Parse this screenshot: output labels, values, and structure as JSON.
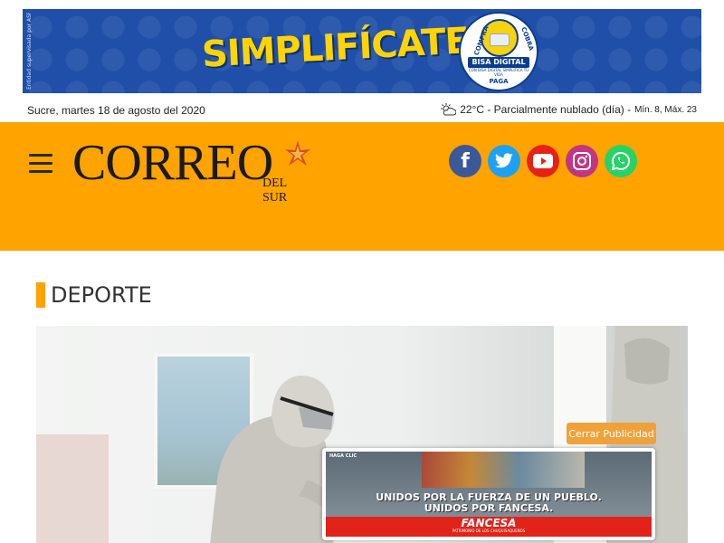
{
  "top_ad": {
    "headline": "SIMPLIFÍCATE",
    "disclaimer": "Entidad supervisada por ASFI",
    "seal_left": "COMPRA",
    "seal_right": "COBRA",
    "seal_center": "BISA DIGITAL",
    "seal_subtext": "CON BISA DIGITAL SIMPLIFICA TU VIDA",
    "seal_bottom": "PAGA"
  },
  "info_bar": {
    "date": "Sucre, martes 18 de agosto del 2020",
    "weather_icon": "partly-cloudy-icon",
    "weather_main": "22°C - Parcialmente nublado (día) -",
    "weather_minmax": "Mín. 8, Máx. 23"
  },
  "header": {
    "background_color": "#ffa300",
    "menu_icon": "hamburger-menu-icon",
    "logo_main": "CORREO",
    "logo_sub": "DEL SUR",
    "social": [
      {
        "name": "facebook",
        "glyph": "f",
        "color": "#3b5998"
      },
      {
        "name": "twitter",
        "glyph": "",
        "color": "#1da1f2"
      },
      {
        "name": "youtube",
        "glyph": "",
        "color": "#e62117"
      },
      {
        "name": "instagram",
        "glyph": "",
        "color": "#c13584"
      },
      {
        "name": "whatsapp",
        "glyph": "",
        "color": "#25d366"
      }
    ]
  },
  "section": {
    "title": "DEPORTE",
    "accent_color": "#ffa300"
  },
  "popup": {
    "close_label": "Cerrar Publicidad",
    "ad_tag": "HAGA CLIC",
    "slogan_line1": "UNIDOS POR LA FUERZA DE UN PUEBLO.",
    "slogan_line2": "UNIDOS POR FANCESA.",
    "brand": "FANCESA",
    "brand_sub": "PATRIMONIO DE LOS CHUQUISAQUEÑOS"
  }
}
